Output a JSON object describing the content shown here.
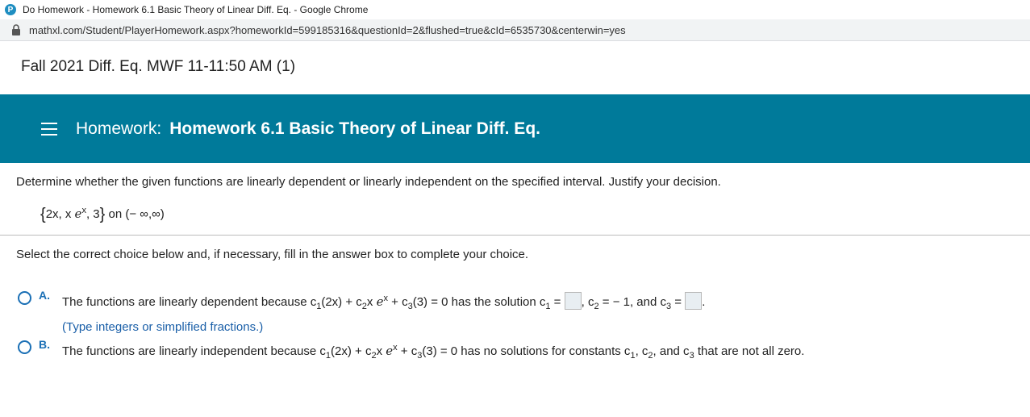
{
  "window": {
    "title": "Do Homework - Homework 6.1 Basic Theory of Linear Diff. Eq. - Google Chrome",
    "url": "mathxl.com/Student/PlayerHomework.aspx?homeworkId=599185316&questionId=2&flushed=true&cId=6535730&centerwin=yes"
  },
  "course": {
    "title": "Fall 2021 Diff. Eq. MWF 11-11:50 AM (1)"
  },
  "banner": {
    "label": "Homework:",
    "name": "Homework 6.1 Basic Theory of Linear Diff. Eq."
  },
  "question": {
    "prompt": "Determine whether the given functions are linearly dependent or linearly independent on the specified interval. Justify your decision.",
    "set": {
      "open": "{",
      "f1": "2x, x",
      "e": "e",
      "exp": "x",
      "sep": ", 3",
      "close": "}",
      "interval": " on (− ∞,∞)"
    }
  },
  "instructions": "Select the correct choice below and, if necessary, fill in the answer box to complete your choice.",
  "choices": {
    "a": {
      "letter": "A.",
      "t1": "The functions are linearly dependent because c",
      "s1": "1",
      "t2": "(2x) + c",
      "s2": "2",
      "t3": "x ",
      "e": "e",
      "exp": "x",
      "t4": " + c",
      "s3": "3",
      "t5": "(3) = 0 has the solution c",
      "s4": "1",
      "t6": " = ",
      "t7": ", c",
      "s5": "2",
      "t8": " = − 1, and c",
      "s6": "3",
      "t9": " = ",
      "t10": ".",
      "hint": "(Type integers or simplified fractions.)",
      "c1_value": "",
      "c3_value": ""
    },
    "b": {
      "letter": "B.",
      "t1": "The functions are linearly independent because c",
      "s1": "1",
      "t2": "(2x) + c",
      "s2": "2",
      "t3": "x ",
      "e": "e",
      "exp": "x",
      "t4": " + c",
      "s3": "3",
      "t5": "(3) = 0 has no solutions for constants c",
      "s4": "1",
      "t6": ", c",
      "s5": "2",
      "t7": ", and c",
      "s6": "3",
      "t8": " that are not all zero."
    }
  },
  "colors": {
    "banner": "#007a9a",
    "choice_accent": "#1a6fb5"
  }
}
